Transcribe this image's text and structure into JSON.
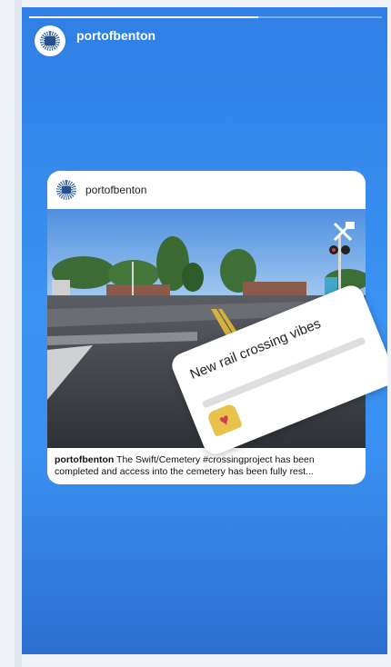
{
  "story": {
    "username": "portofbenton",
    "progress_fraction": 0.65
  },
  "post": {
    "username": "portofbenton",
    "caption_user": "portofbenton",
    "caption_text": " The Swift/Cemetery #crossingproject has been completed and access into the cemetery has been fully rest..."
  },
  "poll": {
    "question": "New rail crossing vibes",
    "emoji": "heart-eyes-emoji"
  },
  "colors": {
    "story_bg": "#3a8ff0",
    "card_bg": "#ffffff"
  }
}
